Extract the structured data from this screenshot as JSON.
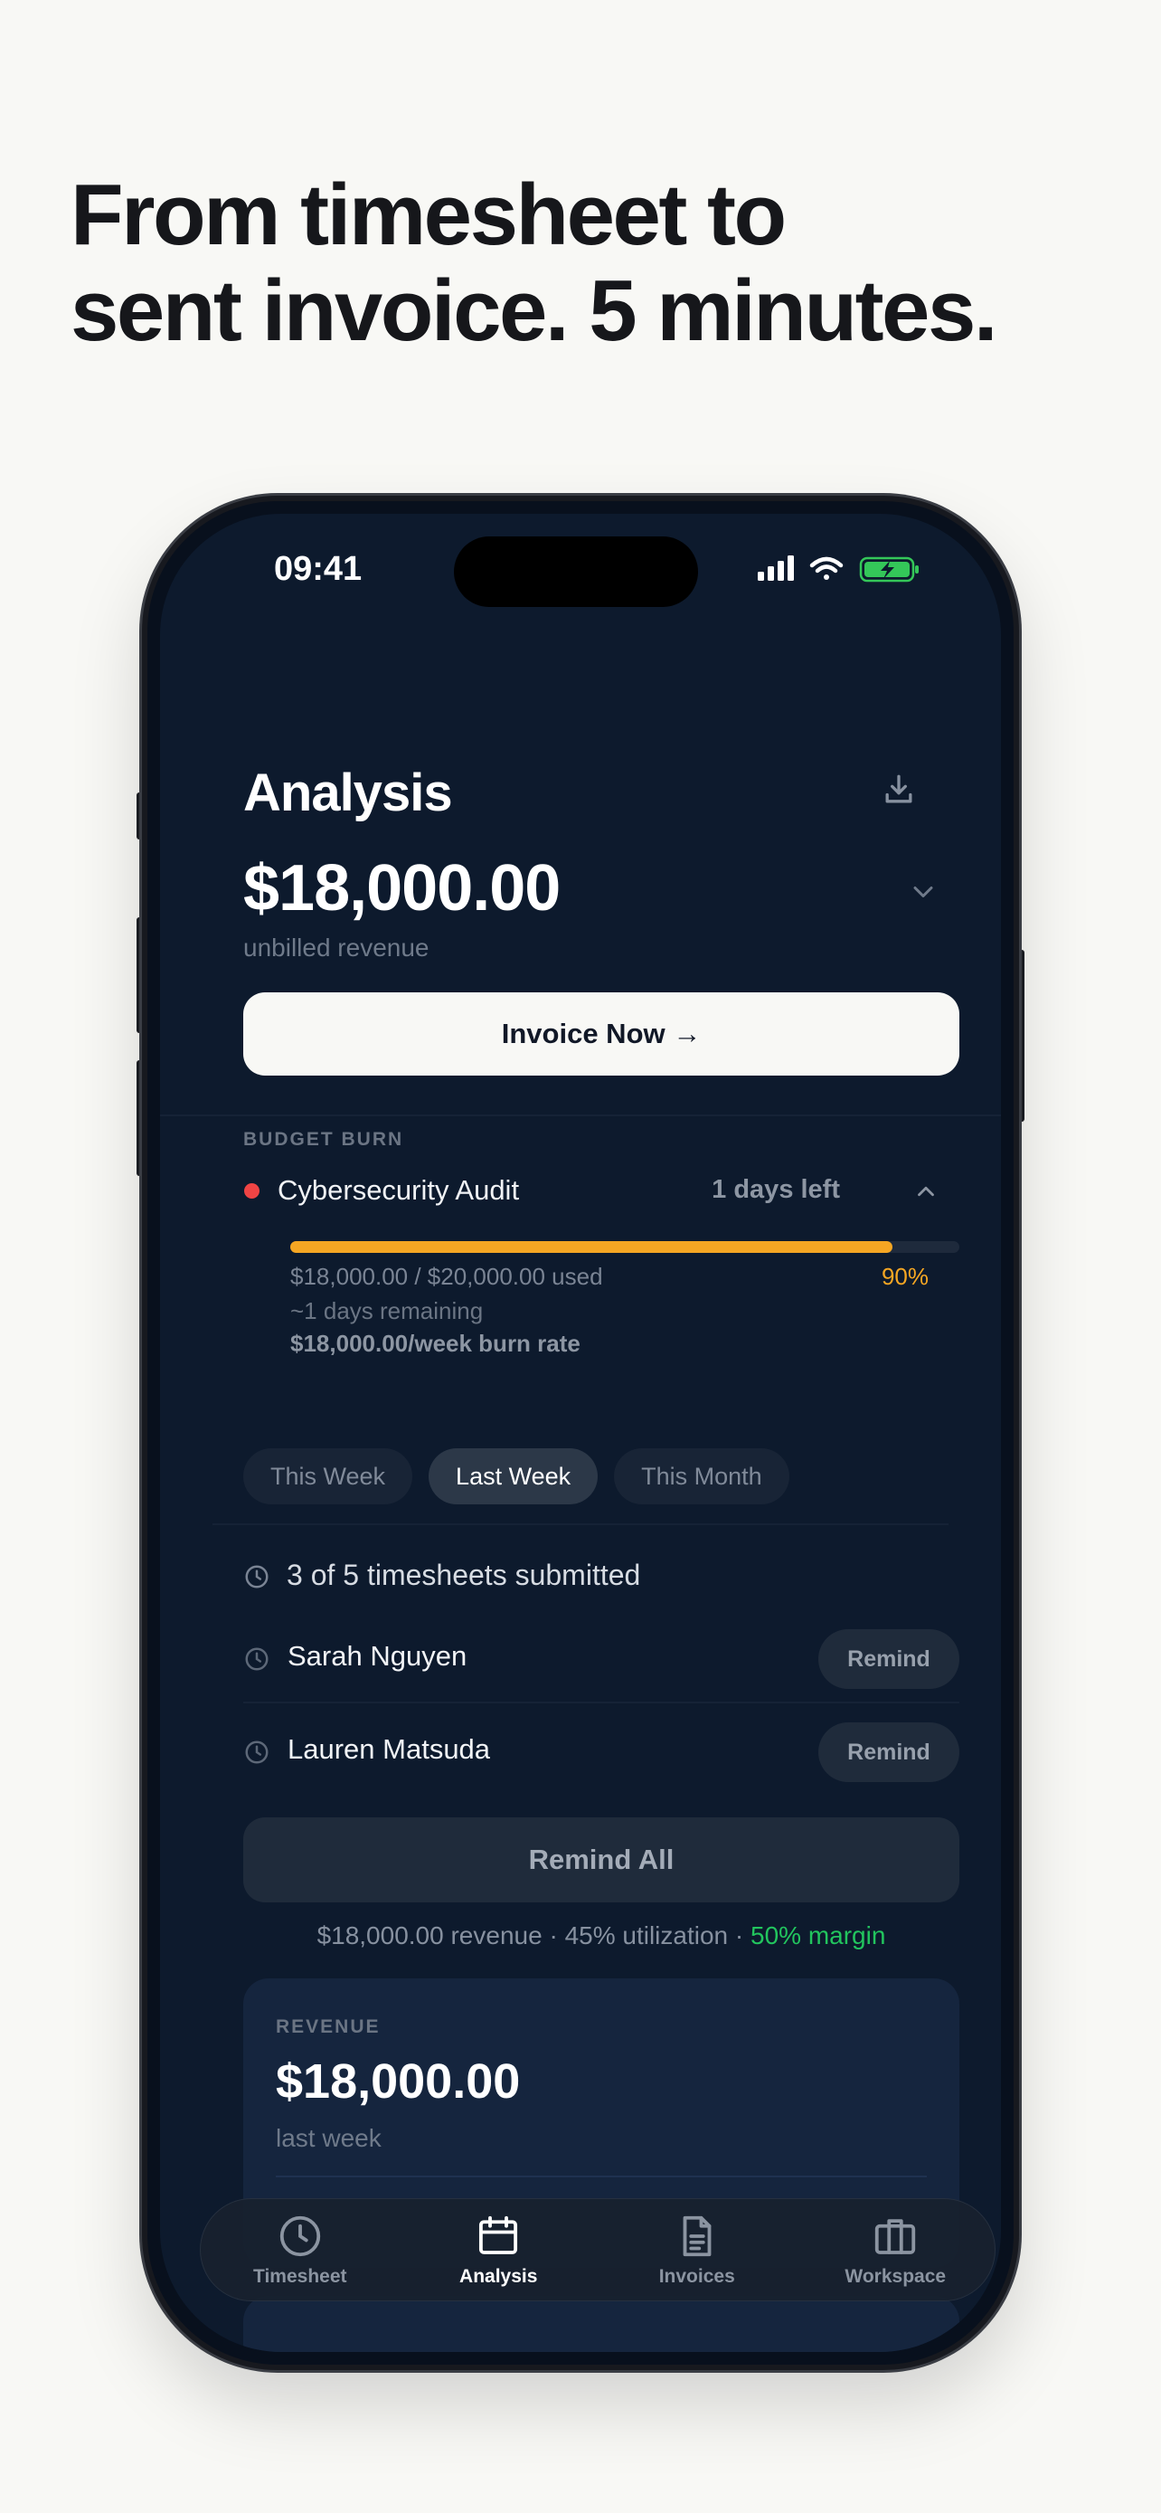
{
  "headline": [
    "From timesheet to",
    "sent invoice. 5 minutes."
  ],
  "status_bar": {
    "time": "09:41"
  },
  "screen": {
    "title": "Analysis",
    "amount": "$18,000.00",
    "amount_sub": "unbilled revenue",
    "invoice_button": "Invoice Now →"
  },
  "budget_burn": {
    "label": "BUDGET BURN",
    "project": "Cybersecurity Audit",
    "days_left": "1 days left",
    "used": "$18,000.00 / $20,000.00 used",
    "percent": "90%",
    "progress": 0.9,
    "remaining": "~1 days remaining",
    "burn_rate": "$18,000.00/week burn rate",
    "status_color": "#ef4444",
    "bar_color": "#f5a623"
  },
  "period_tabs": [
    "This Week",
    "Last Week",
    "This Month"
  ],
  "active_tab": "Last Week",
  "timesheets": {
    "summary": "3 of 5 timesheets submitted",
    "people": [
      {
        "name": "Sarah Nguyen",
        "action": "Remind"
      },
      {
        "name": "Lauren Matsuda",
        "action": "Remind"
      }
    ],
    "remind_all": "Remind All"
  },
  "summary": {
    "revenue": "$18,000.00 revenue",
    "separator": " · ",
    "utilization": "45% utilization",
    "margin": "50% margin",
    "margin_color": "#22c55e"
  },
  "revenue_card": {
    "label": "REVENUE",
    "amount": "$18,000.00",
    "sub": "last week"
  },
  "tabbar": {
    "items": [
      {
        "label": "Timesheet",
        "icon": "clock-icon"
      },
      {
        "label": "Analysis",
        "icon": "calendar-icon"
      },
      {
        "label": "Invoices",
        "icon": "document-icon"
      },
      {
        "label": "Workspace",
        "icon": "briefcase-icon"
      }
    ],
    "active": "Analysis"
  }
}
